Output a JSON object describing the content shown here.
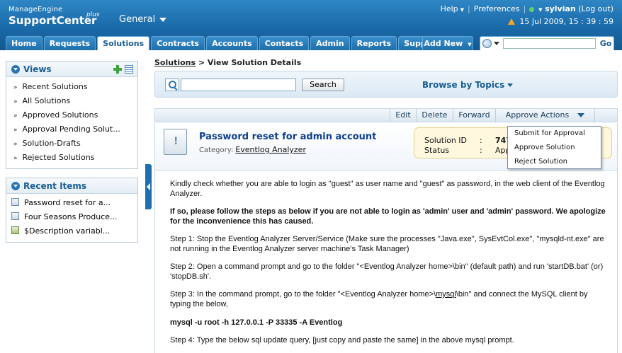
{
  "header": {
    "brand_top": "ManageEngine",
    "brand_main": "SupportCenter",
    "brand_plus": "plus",
    "context": "General",
    "help": "Help",
    "preferences": "Preferences",
    "user": "sylvian",
    "logout": "(Log out)",
    "datetime": "15 Jul 2009, 15 : 39 : 59",
    "tabs": [
      "Home",
      "Requests",
      "Solutions",
      "Contracts",
      "Accounts",
      "Contacts",
      "Admin",
      "Reports",
      "Support"
    ],
    "active_tab": "Solutions",
    "add_new": "Add New",
    "go": "Go"
  },
  "sidebar": {
    "views_title": "Views",
    "views": [
      "Recent Solutions",
      "All Solutions",
      "Approved Solutions",
      "Approval Pending Solut...",
      "Solution-Drafts",
      "Rejected Solutions"
    ],
    "recent_title": "Recent Items",
    "recent": [
      "Password reset for a...",
      "Four Seasons Produce...",
      "$Description variabl..."
    ]
  },
  "main": {
    "breadcrumb_link": "Solutions",
    "breadcrumb_current": " > View Solution Details",
    "search_button": "Search",
    "browse_topics": "Browse by Topics",
    "actions": [
      "Edit",
      "Delete",
      "Forward",
      "Approve Actions"
    ],
    "title": "Password reset for admin account",
    "category_label": "Category:",
    "category": "Eventlog Analyzer",
    "solution_id_label": "Solution ID",
    "solution_id_colon": ":",
    "solution_id": "747",
    "status_label": "Status",
    "status_colon": ":",
    "status_value": "App",
    "approve_menu": [
      "Submit for Approval",
      "Approve Solution",
      "Reject Solution"
    ],
    "body": {
      "p1": "Kindly check whether you are able to login as \"guest\" as user name and \"guest\" as password, in the web client of the Eventlog Analyzer.",
      "p2": "If so, please follow the steps as below if you are not able to login as 'admin' user and 'admin' password.  We apologize for the inconvenience this has caused.",
      "p3": "Step 1:  Stop the Eventlog Analyzer Server/Service (Make sure the processes \"Java.exe\", SysEvtCol.exe\", \"mysqld-nt.exe\" are not running in the Eventlog Analyzer server machine's Task Manager)",
      "p4": "Step 2:  Open a command prompt and go to the folder  \"<Eventlog Analyzer home>\\bin\" (default path) and run 'startDB.bat' (or) 'stopDB.sh'.",
      "p5a": "Step 3:  In the command prompt, go to the folder \"<Eventlog Analyzer home>\\",
      "p5b": "mysql",
      "p5c": "\\bin\" and connect the MySQL client by typing the below,",
      "p6": "mysql  -u  root  -h  127.0.0.1  -P 33335 -A Eventlog",
      "p7": "Step 4:  Type the below sql update query, [just copy and paste the same] in the above mysql prompt."
    }
  }
}
